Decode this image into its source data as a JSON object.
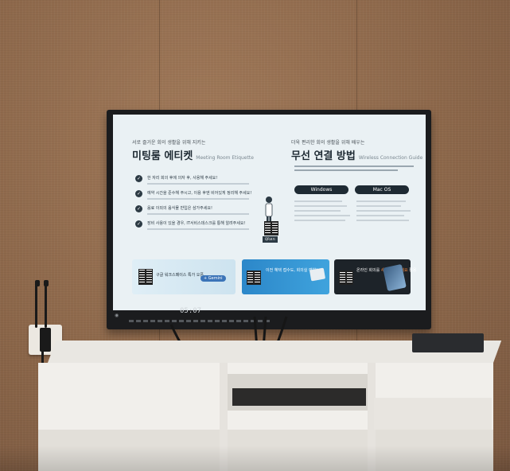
{
  "screen": {
    "left_panel": {
      "supertitle": "서로 즐거운 회의 생활을 위해 지키는",
      "title": "미팅룸 에티켓",
      "title_en": "Meeting Room Etiquette",
      "rules": [
        "한 자리 회의 후에 의자 후, 사용해 주세요!",
        "예약 시간을 준수해 주시고, 이용 후엔 비어있게 정리해 주세요!",
        "음료 이외의 음식물 반입은 삼가주세요!",
        "장비 사용이 있을 경우, IT서비스데스크를 통해 알려주세요!"
      ],
      "qr_label": "QR코드"
    },
    "right_panel": {
      "supertitle": "더욱 편리한 회의 생활을 위해 배우는",
      "title": "무선 연결 방법",
      "title_en": "Wireless Connection Guide",
      "tabs": [
        "Windows",
        "Mac OS"
      ]
    },
    "banners": [
      {
        "text": "구글 워크스페이스 특가 오픈",
        "pill": "+ Gemini"
      },
      {
        "text": "이전 혜택 접수도, 회의실 예약!"
      },
      {
        "text_plain": "온라인 회의를 ",
        "text_highlight": "새로 분리하세요",
        "text_end": " 활용"
      }
    ],
    "clock": "05:07"
  },
  "colors": {
    "wall": "#8d6a4e",
    "screen_bg": "#eaf1f4",
    "cabinet": "#f1efeb",
    "bezel": "#1b1c1e"
  }
}
